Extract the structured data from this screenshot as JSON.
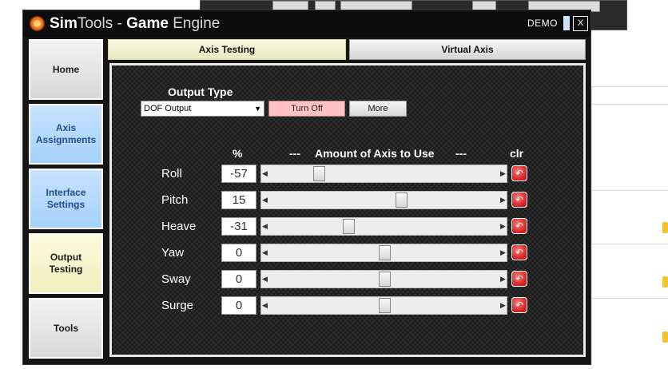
{
  "window": {
    "title_sim": "Sim",
    "title_tools": "Tools",
    "title_dash": " - ",
    "title_game": "Game",
    "title_engine": " Engine",
    "demo": "DEMO",
    "close": "X"
  },
  "sidebar": {
    "items": [
      {
        "label": "Home"
      },
      {
        "label": "Axis\nAssignments"
      },
      {
        "label": "Interface\nSettings"
      },
      {
        "label": "Output\nTesting"
      },
      {
        "label": "Tools"
      }
    ]
  },
  "tabs": [
    {
      "label": "Axis Testing",
      "active": true
    },
    {
      "label": "Virtual Axis",
      "active": false
    }
  ],
  "output": {
    "type_label": "Output Type",
    "selected": "DOF Output",
    "turn_off": "Turn Off",
    "more": "More"
  },
  "table": {
    "percent_header": "%",
    "dash": "---",
    "amount_header": "Amount of Axis to Use",
    "clr_header": "clr"
  },
  "axes": [
    {
      "name": "Roll",
      "value": "-57",
      "percent": -57
    },
    {
      "name": "Pitch",
      "value": "15",
      "percent": 15
    },
    {
      "name": "Heave",
      "value": "-31",
      "percent": -31
    },
    {
      "name": "Yaw",
      "value": "0",
      "percent": 0
    },
    {
      "name": "Sway",
      "value": "0",
      "percent": 0
    },
    {
      "name": "Surge",
      "value": "0",
      "percent": 0
    }
  ],
  "colors": {
    "accent_blue": "#a6d1fb",
    "accent_yellow": "#efefbf",
    "turn_off_pink": "#ffc2c2",
    "clr_red": "#d21f1f"
  },
  "icons": {
    "clr": "undo-arrow-icon",
    "close": "close-icon",
    "logo": "simtools-logo-icon"
  }
}
